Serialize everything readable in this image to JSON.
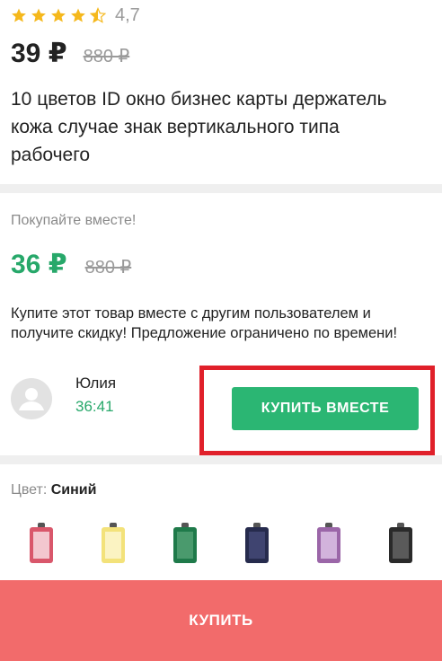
{
  "product": {
    "rating": "4,7",
    "rating_stars": 4.5,
    "price": "39 ₽",
    "old_price": "880 ₽",
    "title": "10 цветов ID окно бизнес карты держатель кожа случае знак вертикального типа рабочего"
  },
  "together": {
    "label": "Покупайте вместе!",
    "price": "36 ₽",
    "old_price": "880 ₽",
    "description": "Купите этот товар вместе с другим пользователем и получите скидку! Предложение ограничено по времени!",
    "user_name": "Юлия",
    "timer": "36:41",
    "button_label": "КУПИТЬ ВМЕСТЕ"
  },
  "color": {
    "label": "Цвет:",
    "value": "Синий",
    "swatches": [
      {
        "name": "red",
        "color": "#d9576b"
      },
      {
        "name": "yellow",
        "color": "#f3e27a"
      },
      {
        "name": "green",
        "color": "#1f7a4a"
      },
      {
        "name": "navy",
        "color": "#262b4d"
      },
      {
        "name": "purple",
        "color": "#9b66a8"
      },
      {
        "name": "black",
        "color": "#2a2a2a"
      }
    ]
  },
  "buy": {
    "label": "КУПИТЬ"
  },
  "colors": {
    "accent_green": "#2bb673",
    "price_green": "#27a86a",
    "highlight_red": "#e0202a",
    "buy_bar": "#f26b6b",
    "star": "#f5b81c"
  }
}
